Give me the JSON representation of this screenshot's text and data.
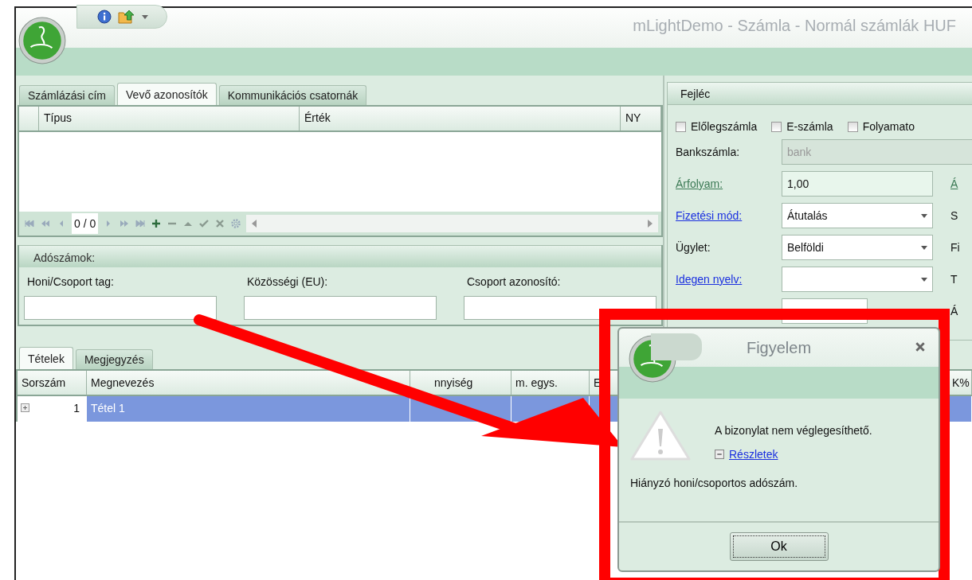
{
  "window": {
    "title": "mLightDemo - Számla - Normál számlák HUF"
  },
  "left_tabs": [
    {
      "label": "Számlázási cím",
      "selected": false
    },
    {
      "label": "Vevő azonosítók",
      "selected": true
    },
    {
      "label": "Kommunikációs csatornák",
      "selected": false
    }
  ],
  "id_grid": {
    "columns": [
      "Típus",
      "Érték",
      "NY"
    ]
  },
  "navigator": {
    "position": "0 / 0"
  },
  "tax_numbers": {
    "title": "Adószámok:",
    "fields": [
      {
        "label": "Honi/Csoport tag:"
      },
      {
        "label": "Közösségi (EU):"
      },
      {
        "label": "Csoport azonosító:"
      }
    ]
  },
  "header_panel": {
    "title": "Fejléc",
    "checkboxes": [
      {
        "label": "Előlegszámla",
        "checked": false
      },
      {
        "label": "E-számla",
        "checked": false
      },
      {
        "label": "Folyamato",
        "checked": false
      }
    ],
    "fields": [
      {
        "label": "Bankszámla:",
        "label_link": false,
        "kind": "text",
        "value": "bank",
        "disabled": true
      },
      {
        "label": "Árfolyam:",
        "label_link": true,
        "label_muted": true,
        "kind": "readonly",
        "value": "1,00",
        "disabled": false,
        "side_label": "Á",
        "side_link": true
      },
      {
        "label": "Fizetési mód:",
        "label_link": true,
        "label_muted": false,
        "kind": "combo",
        "value": "Átutalás",
        "disabled": false,
        "side_label": "S",
        "side_link": false
      },
      {
        "label": "Ügylet:",
        "label_link": false,
        "kind": "combo",
        "value": "Belföldi",
        "disabled": false,
        "side_label": "Fi",
        "side_link": false
      },
      {
        "label": "Idegen nyelv:",
        "label_link": true,
        "label_muted": false,
        "kind": "combo",
        "disabled": false,
        "side_label": "T",
        "side_link": false
      },
      {
        "kind": "short",
        "disabled": false,
        "side_label": "Á",
        "side_link": false
      }
    ]
  },
  "bottom_tabs": [
    {
      "label": "Tételek",
      "selected": true
    },
    {
      "label": "Megjegyzés",
      "selected": false
    }
  ],
  "items_grid": {
    "columns": [
      "Sorszám",
      "Megnevezés",
      "nnyiség",
      "m. egys.",
      "E",
      "K%"
    ],
    "rows": [
      {
        "number": "1",
        "name": "Tétel 1",
        "selected": true,
        "expanded": false
      }
    ]
  },
  "dialog": {
    "title": "Figyelem",
    "message": "A bizonylat nem véglegesíthető.",
    "details_link": "Részletek",
    "details_expanded": true,
    "details": "Hiányzó honi/csoportos adószám.",
    "button": "Ok"
  }
}
